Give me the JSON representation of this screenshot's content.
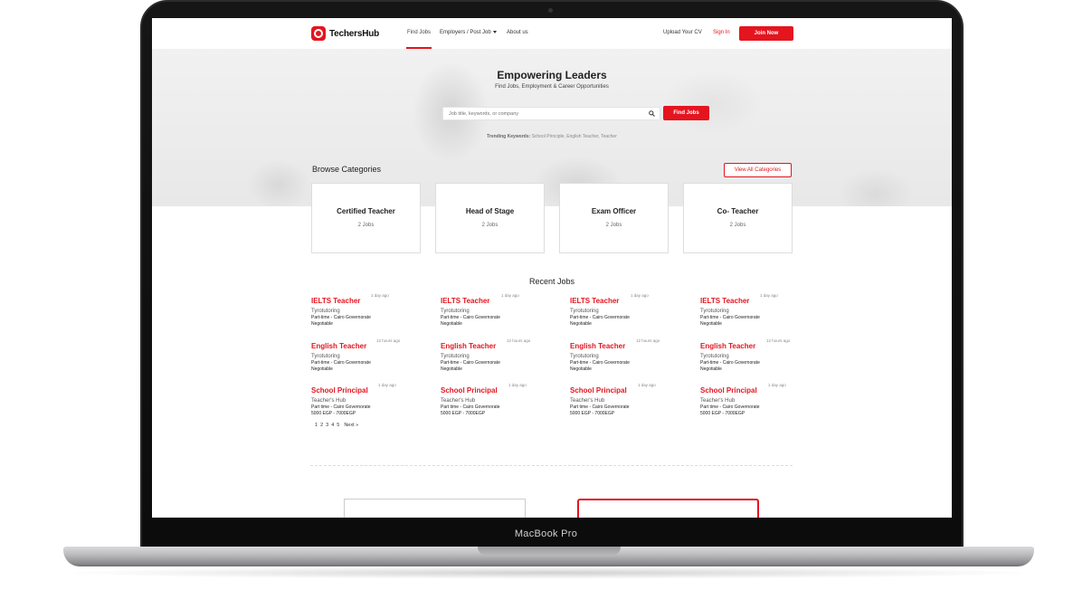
{
  "device": {
    "label": "MacBook Pro"
  },
  "site": {
    "brand": "TechersHub",
    "nav": {
      "find_jobs": "Find Jobs",
      "employers": "Employers / Post Job",
      "about": "About us",
      "upload_cv": "Upload Your CV",
      "sign_in": "Sign In",
      "join": "Join Now"
    },
    "hero": {
      "title": "Empowering Leaders",
      "subtitle": "Find Jobs, Employment & Career Opportunities",
      "search_placeholder": "Job title, keywords, or company",
      "find_button": "Find Jobs",
      "trending_label": "Trending Keywords:",
      "trending_values": "School Principle, English Teacher, Teacher"
    },
    "categories": {
      "title": "Browse Categories",
      "view_all": "View All Categories",
      "items": [
        {
          "name": "Certified Teacher",
          "count": "2 Jobs"
        },
        {
          "name": "Head of Stage",
          "count": "2 Jobs"
        },
        {
          "name": "Exam Officer",
          "count": "2 Jobs"
        },
        {
          "name": "Co- Teacher",
          "count": "2 Jobs"
        }
      ]
    },
    "recent_jobs": {
      "title": "Recent Jobs",
      "items": [
        {
          "title": "IELTS Teacher",
          "age": "1 day ago",
          "company": "Tyrotutoring",
          "meta": "Part-time - Cairo Governorate",
          "salary": "Negotiable"
        },
        {
          "title": "IELTS Teacher",
          "age": "1 day ago",
          "company": "Tyrotutoring",
          "meta": "Part-time - Cairo Governorate",
          "salary": "Negotiable"
        },
        {
          "title": "IELTS Teacher",
          "age": "1 day ago",
          "company": "Tyrotutoring",
          "meta": "Part-time - Cairo Governorate",
          "salary": "Negotiable"
        },
        {
          "title": "IELTS Teacher",
          "age": "1 day ago",
          "company": "Tyrotutoring",
          "meta": "Part-time - Cairo Governorate",
          "salary": "Negotiable"
        },
        {
          "title": "English Teacher",
          "age": "12 hours ago",
          "company": "Tyrotutoring",
          "meta": "Part-time - Cairo Governorate",
          "salary": "Negotiable"
        },
        {
          "title": "English Teacher",
          "age": "12 hours ago",
          "company": "Tyrotutoring",
          "meta": "Part-time - Cairo Governorate",
          "salary": "Negotiable"
        },
        {
          "title": "English Teacher",
          "age": "12 hours ago",
          "company": "Tyrotutoring",
          "meta": "Part-time - Cairo Governorate",
          "salary": "Negotiable"
        },
        {
          "title": "English Teacher",
          "age": "12 hours ago",
          "company": "Tyrotutoring",
          "meta": "Part-time - Cairo Governorate",
          "salary": "Negotiable"
        },
        {
          "title": "School Principal",
          "age": "1 day ago",
          "company": "Teacher's Hub",
          "meta": "Part time - Cairo Governorate",
          "salary": "5000 EGP - 7000EGP"
        },
        {
          "title": "School Principal",
          "age": "1 day ago",
          "company": "Teacher's Hub",
          "meta": "Part time - Cairo Governorate",
          "salary": "5000 EGP - 7000EGP"
        },
        {
          "title": "School Principal",
          "age": "1 day ago",
          "company": "Teacher's Hub",
          "meta": "Part time - Cairo Governorate",
          "salary": "5000 EGP - 7000EGP"
        },
        {
          "title": "School Principal",
          "age": "1 day ago",
          "company": "Teacher's Hub",
          "meta": "Part time - Cairo Governorate",
          "salary": "5000 EGP - 7000EGP"
        }
      ]
    },
    "pagination": {
      "pages": [
        "1",
        "2",
        "3",
        "4",
        "5"
      ],
      "next": "Next »"
    },
    "colors": {
      "accent": "#e4151f"
    }
  }
}
